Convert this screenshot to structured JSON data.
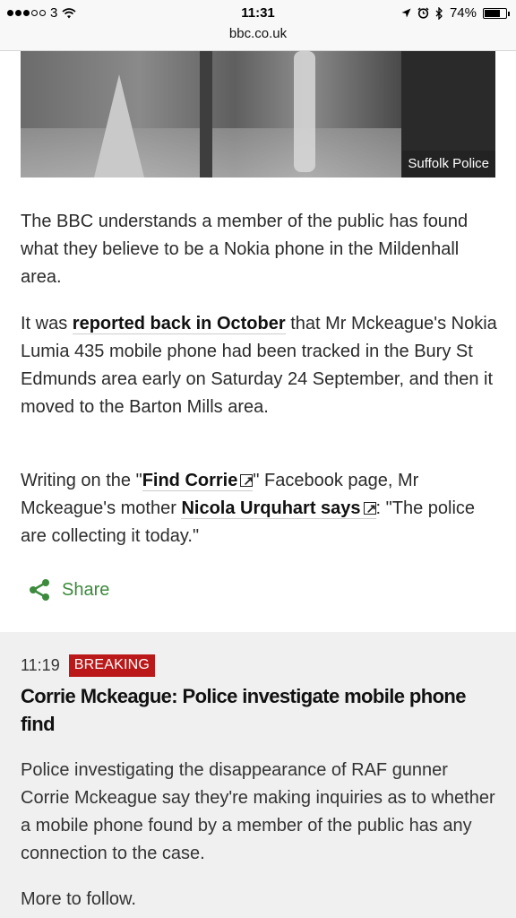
{
  "status_bar": {
    "carrier": "3",
    "time": "11:31",
    "battery": "74%",
    "battery_level": 0.74,
    "url": "bbc.co.uk"
  },
  "image": {
    "caption": "Suffolk Police"
  },
  "article": {
    "p1": "The BBC understands a member of the public has found what they believe to be a Nokia phone in the Mildenhall area.",
    "p2_pre": "It was ",
    "p2_link": "reported back in October",
    "p2_post": " that Mr Mckeague's Nokia Lumia 435 mobile phone had been tracked in the Bury St Edmunds area early on Saturday 24 September, and then it moved to the Barton Mills area.",
    "p3_pre": "Writing on the \"",
    "p3_link1": "Find Corrie",
    "p3_mid": "\" Facebook page, Mr Mckeague's mother ",
    "p3_link2": "Nicola Urquhart says",
    "p3_post": ": \"The police are collecting it today.\"",
    "share_label": "Share"
  },
  "update": {
    "time": "11:19",
    "badge": "BREAKING",
    "headline": "Corrie Mckeague: Police investigate mobile phone find",
    "body": "Police investigating the disappearance of RAF gunner Corrie Mckeague say they're making inquiries as to whether a mobile phone found by a member of the public has any connection to the case.",
    "footer": "More to follow."
  },
  "colors": {
    "breaking": "#bb1919",
    "share": "#3c8a3c"
  }
}
